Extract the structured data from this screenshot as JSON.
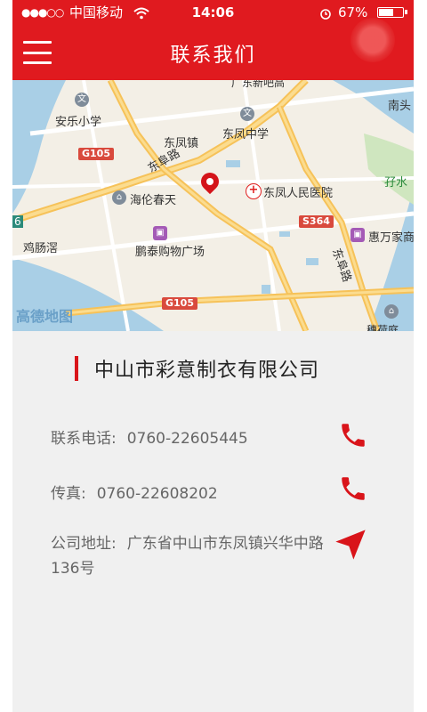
{
  "status_bar": {
    "signal": "●●●○○",
    "carrier": "中国移动",
    "time": "14:06",
    "battery_text": "67%",
    "battery_level": 0.67
  },
  "header": {
    "title": "联系我们",
    "menu_icon": "menu-icon"
  },
  "map": {
    "labels": {
      "l1": "广东新吧高",
      "l2": "南头",
      "l3": "安乐小学",
      "l4": "东凤镇",
      "l5": "东凤中学",
      "l6": "东阜路",
      "l7": "海伦春天",
      "l8": "东凤人民医院",
      "l9": "孖水",
      "l10": "鸡肠滘",
      "l11": "鹏泰购物广场",
      "l12": "惠万家商",
      "l13": "东阜路",
      "l14": "东阜路",
      "l15": "穗荷庭",
      "l16": "6"
    },
    "roads": {
      "g105a": "G105",
      "g105b": "G105",
      "s364": "S364"
    },
    "logo": "高德地图"
  },
  "contact": {
    "company_name": "中山市彩意制衣有限公司",
    "phone_label": "联系电话:",
    "phone_value": "0760-22605445",
    "fax_label": "传真:",
    "fax_value": "0760-22608202",
    "address_label": "公司地址:",
    "address_value": "广东省中山市东凤镇兴华中路136号"
  },
  "colors": {
    "brand": "#e01a1f",
    "icon_red": "#d9141a"
  }
}
